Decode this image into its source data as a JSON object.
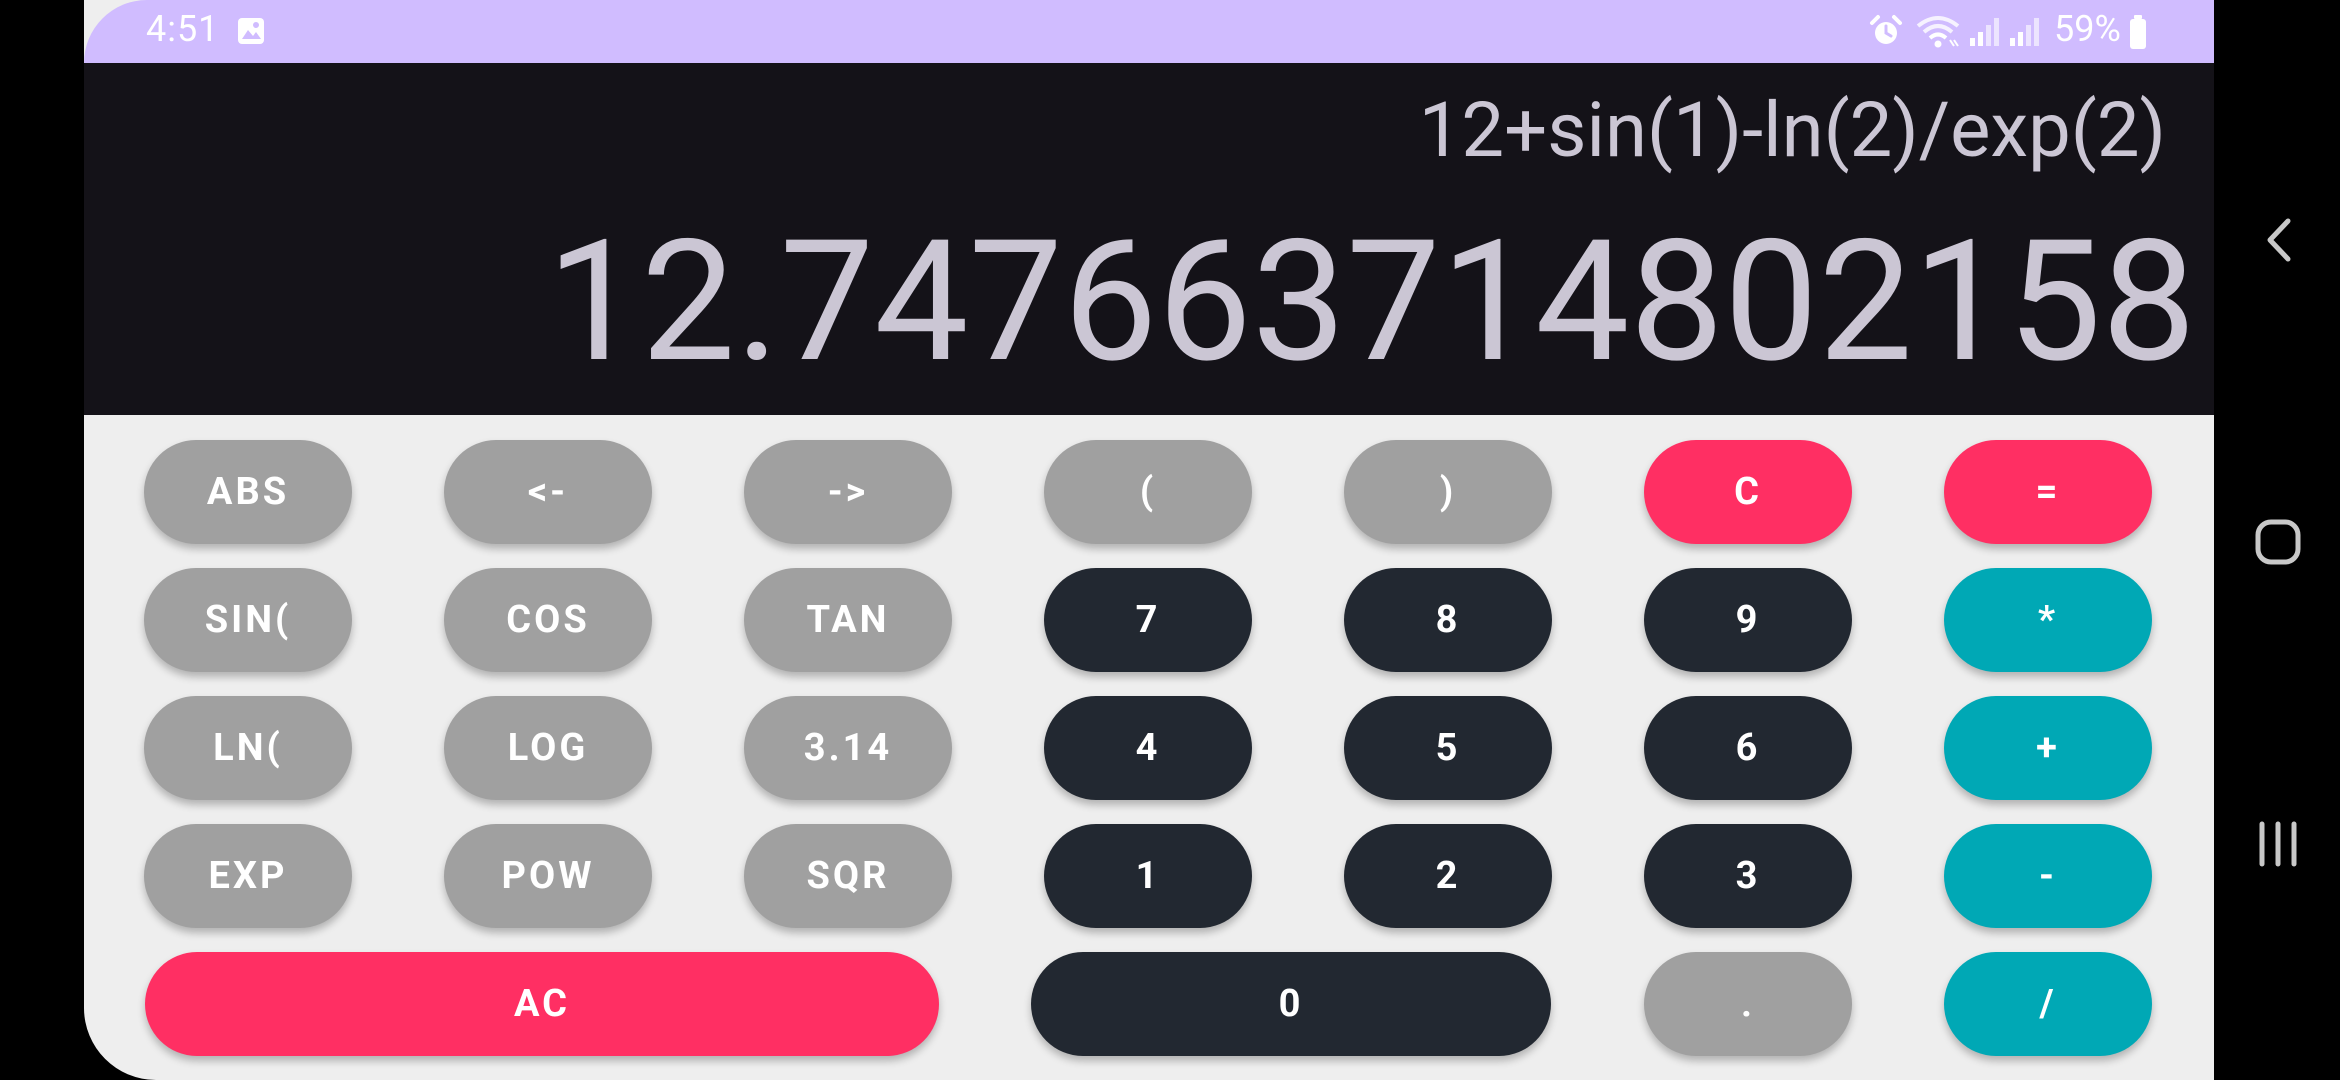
{
  "status_bar": {
    "time": "4:51",
    "battery": "59%",
    "icons": [
      "gallery-icon",
      "alarm-icon",
      "wifi-icon",
      "signal-icon",
      "signal-icon",
      "battery-icon"
    ]
  },
  "display": {
    "expression": "12+sin(1)-ln(2)/exp(2)",
    "result": "12.747663714802158"
  },
  "keypad": {
    "abs": "ABS",
    "left": "<-",
    "right": "->",
    "open_paren": "(",
    "close_paren": ")",
    "clear": "C",
    "equals": "=",
    "sin": "SIN(",
    "cos": "COS",
    "tan": "TAN",
    "seven": "7",
    "eight": "8",
    "nine": "9",
    "multiply": "*",
    "ln": "LN(",
    "log": "LOG",
    "pi": "3.14",
    "four": "4",
    "five": "5",
    "six": "6",
    "plus": "+",
    "exp": "EXP",
    "pow": "POW",
    "sqr": "SQR",
    "one": "1",
    "two": "2",
    "three": "3",
    "minus": "-",
    "all_clear": "AC",
    "zero": "0",
    "dot": ".",
    "divide": "/"
  },
  "colors": {
    "status_bar": "#d0bcff",
    "display_bg": "#141218",
    "display_text": "#cbc6d4",
    "keypad_bg": "#eeeeee",
    "gray_key": "#a0a0a0",
    "dark_key": "#222831",
    "red_key": "#ff2f63",
    "teal_key": "#00a8b5"
  },
  "nav": {
    "icons": [
      "back-icon",
      "home-icon",
      "recent-apps-icon"
    ]
  }
}
